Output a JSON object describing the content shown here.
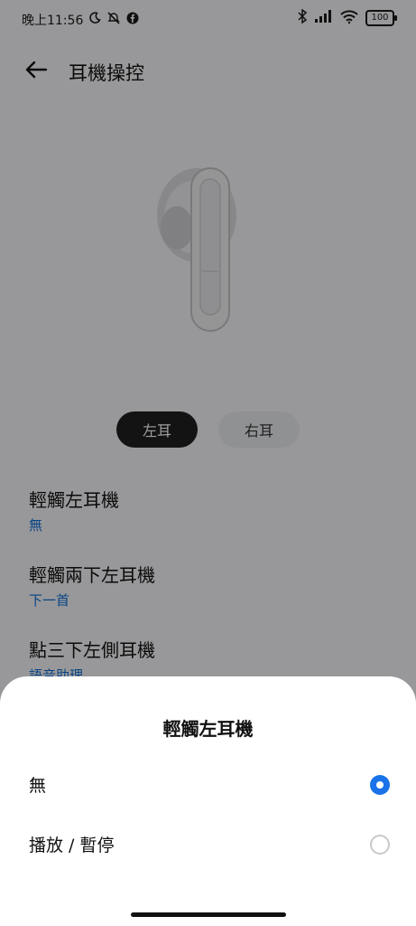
{
  "status_bar": {
    "time": "晚上11:56",
    "battery": "100"
  },
  "header": {
    "title": "耳機操控"
  },
  "ear_toggle": {
    "left": "左耳",
    "right": "右耳"
  },
  "settings": [
    {
      "title": "輕觸左耳機",
      "value": "無"
    },
    {
      "title": "輕觸兩下左耳機",
      "value": "下一首"
    },
    {
      "title": "點三下左側耳機",
      "value": "語音助理"
    }
  ],
  "sheet": {
    "title": "輕觸左耳機",
    "options": [
      {
        "label": "無",
        "selected": true
      },
      {
        "label": "播放 / 暫停",
        "selected": false
      }
    ]
  },
  "colors": {
    "accent": "#1a73e8",
    "value_text": "#0d6fd6"
  }
}
